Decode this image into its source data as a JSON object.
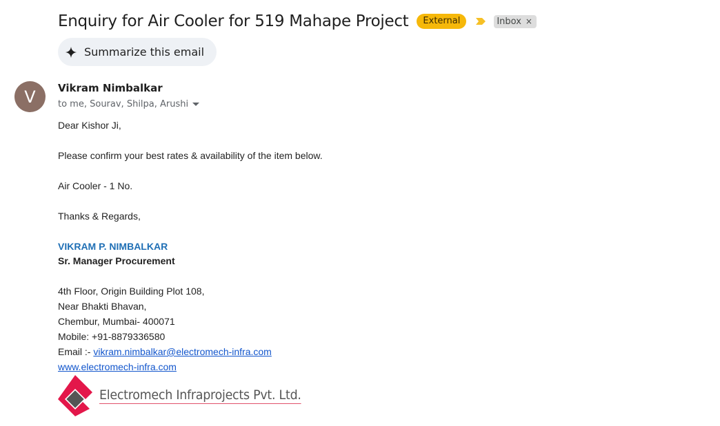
{
  "email": {
    "subject": "Enquiry for Air Cooler for 519 Mahape Project",
    "labels": {
      "external": "External",
      "inbox": "Inbox",
      "inbox_remove": "×"
    },
    "summarize_label": "Summarize this email",
    "sender": {
      "avatar_letter": "V",
      "name": "Vikram Nimbalkar",
      "recipients": "to me, Sourav, Shilpa, Arushi"
    },
    "body": {
      "greeting": "Dear Kishor Ji,",
      "line1": "Please confirm your best rates & availability of the item below.",
      "line2": "Air Cooler - 1 No.",
      "closing": "Thanks & Regards,"
    },
    "signature": {
      "name": "VIKRAM P. NIMBALKAR",
      "title": "Sr. Manager Procurement",
      "address1": "4th Floor, Origin Building Plot 108,",
      "address2": "Near Bhakti Bhavan,",
      "address3": "Chembur, Mumbai- 400071",
      "mobile": "Mobile: +91-8879336580",
      "email_prefix": "Email :- ",
      "email": "vikram.nimbalkar@electromech-infra.com",
      "website": "www.electromech-infra.com",
      "company": "Electromech Infraprojects Pvt. Ltd."
    }
  },
  "colors": {
    "external_badge": "#f6b80a",
    "avatar": "#8b6f65",
    "signature_name": "#1f6fb5",
    "link": "#1155cc",
    "logo_red": "#e3174a"
  }
}
